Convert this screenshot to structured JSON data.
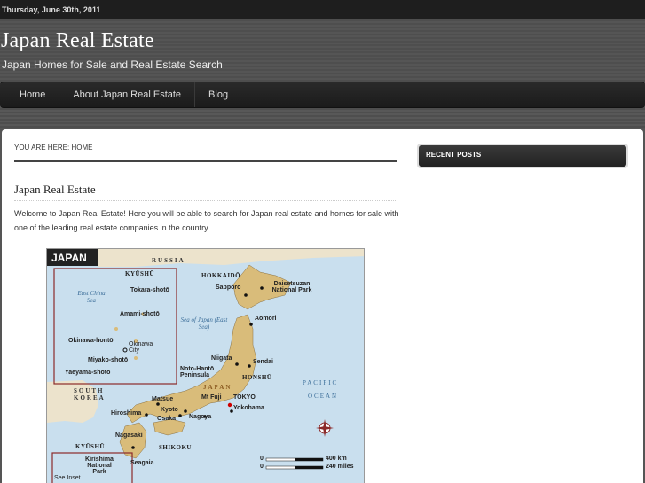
{
  "topbar": {
    "date": "Thursday, June 30th, 2011"
  },
  "header": {
    "title": "Japan Real Estate",
    "description": "Japan Homes for Sale and Real Estate Search"
  },
  "nav": {
    "items": [
      {
        "label": "Home"
      },
      {
        "label": "About Japan Real Estate"
      },
      {
        "label": "Blog"
      }
    ]
  },
  "main": {
    "breadcrumb": "You are here: Home",
    "post_title": "Japan Real Estate",
    "post_body": "Welcome to Japan Real Estate! Here you will be able to search for Japan real estate and homes for sale with one of the leading real estate companies in the country."
  },
  "map": {
    "title": "JAPAN",
    "labels": {
      "russia": "RUSSIA",
      "kyushu_inset": "KYŪSHŪ",
      "tokara": "Tokara-shotō",
      "east_china_sea": "East China Sea",
      "amami": "Amami-shotō",
      "okinawa_honto": "Okinawa-hontō",
      "okinawa_city": "Okinawa City",
      "miyako": "Miyako-shotō",
      "yaeyama": "Yaeyama-shotō",
      "hokkaido": "HOKKAIDŌ",
      "sapporo": "Sapporo",
      "daisetsuzan": "Daisetsuzan National Park",
      "aomori": "Aomori",
      "sea_of_japan": "Sea of Japan (East Sea)",
      "niigata": "Niigata",
      "sendai": "Sendai",
      "noto": "Noto-Hantō Peninsula",
      "honshu": "HONSHŪ",
      "japan": "JAPAN",
      "pacific": "PACIFIC",
      "ocean": "OCEAN",
      "south_korea": "SOUTH KOREA",
      "matsue": "Matsue",
      "mt_fuji": "Mt Fuji",
      "tokyo": "TOKYO",
      "hiroshima": "Hiroshima",
      "kyoto": "Kyoto",
      "osaka": "Osaka",
      "nagoya": "Nagoya",
      "yokohama": "Yokohama",
      "nagasaki": "Nagasaki",
      "kyushu": "KYŪSHŪ",
      "shikoku": "SHIKOKU",
      "kirishima": "Kirishima National Park",
      "seagaia": "Seagaia",
      "see_inset": "See Inset",
      "scale_km": "400 km",
      "scale_miles": "240 miles",
      "scale_zero_1": "0",
      "scale_zero_2": "0"
    },
    "colors": {
      "sea": "#c9dfee",
      "land_japan": "#d9bc7a",
      "land_other": "#ece3cc",
      "inset_border": "#8b2a2a"
    }
  },
  "sidebar": {
    "recent_posts_title": "Recent Posts"
  }
}
